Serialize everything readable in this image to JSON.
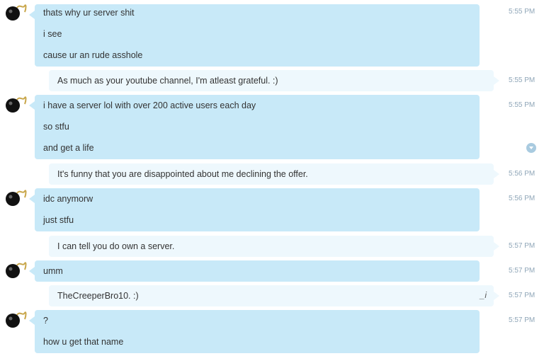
{
  "messages": [
    {
      "id": 1,
      "side": "incoming",
      "time": "5:55 PM",
      "lines": [
        "thats why ur server shit",
        "i see",
        "cause ur an rude asshole"
      ]
    },
    {
      "id": 2,
      "side": "outgoing",
      "time": "5:55 PM",
      "lines": [
        "As much as your youtube channel, I'm atleast grateful. :)"
      ]
    },
    {
      "id": 3,
      "side": "incoming",
      "time": "5:55 PM",
      "lines": [
        "i have a server lol with over 200 active users each day",
        "so stfu",
        "and get a life"
      ]
    },
    {
      "id": 4,
      "side": "outgoing",
      "time": "5:56 PM",
      "lines": [
        "It's funny that you are disappointed about me declining the offer."
      ]
    },
    {
      "id": 5,
      "side": "incoming",
      "time": "5:56 PM",
      "lines": [
        "idc anymorw",
        "just stfu"
      ]
    },
    {
      "id": 6,
      "side": "outgoing",
      "time": "5:57 PM",
      "lines": [
        "I can tell you do own a server."
      ]
    },
    {
      "id": 7,
      "side": "incoming",
      "time": "5:57 PM",
      "lines": [
        "umm"
      ]
    },
    {
      "id": 8,
      "side": "outgoing",
      "time": "5:57 PM",
      "lines": [
        "TheCreeperBro10. :)"
      ],
      "edit_mark": "_i"
    },
    {
      "id": 9,
      "side": "incoming",
      "time": "5:57 PM",
      "lines": [
        "?",
        "how u get that name"
      ]
    }
  ],
  "icons": {
    "avatar": "bomb-avatar-icon",
    "scroll": "scroll-down-icon"
  },
  "colors": {
    "incoming": "#c8e9f8",
    "outgoing": "#eef8fd",
    "timestamp": "#8fa6b8",
    "text": "#333333"
  }
}
